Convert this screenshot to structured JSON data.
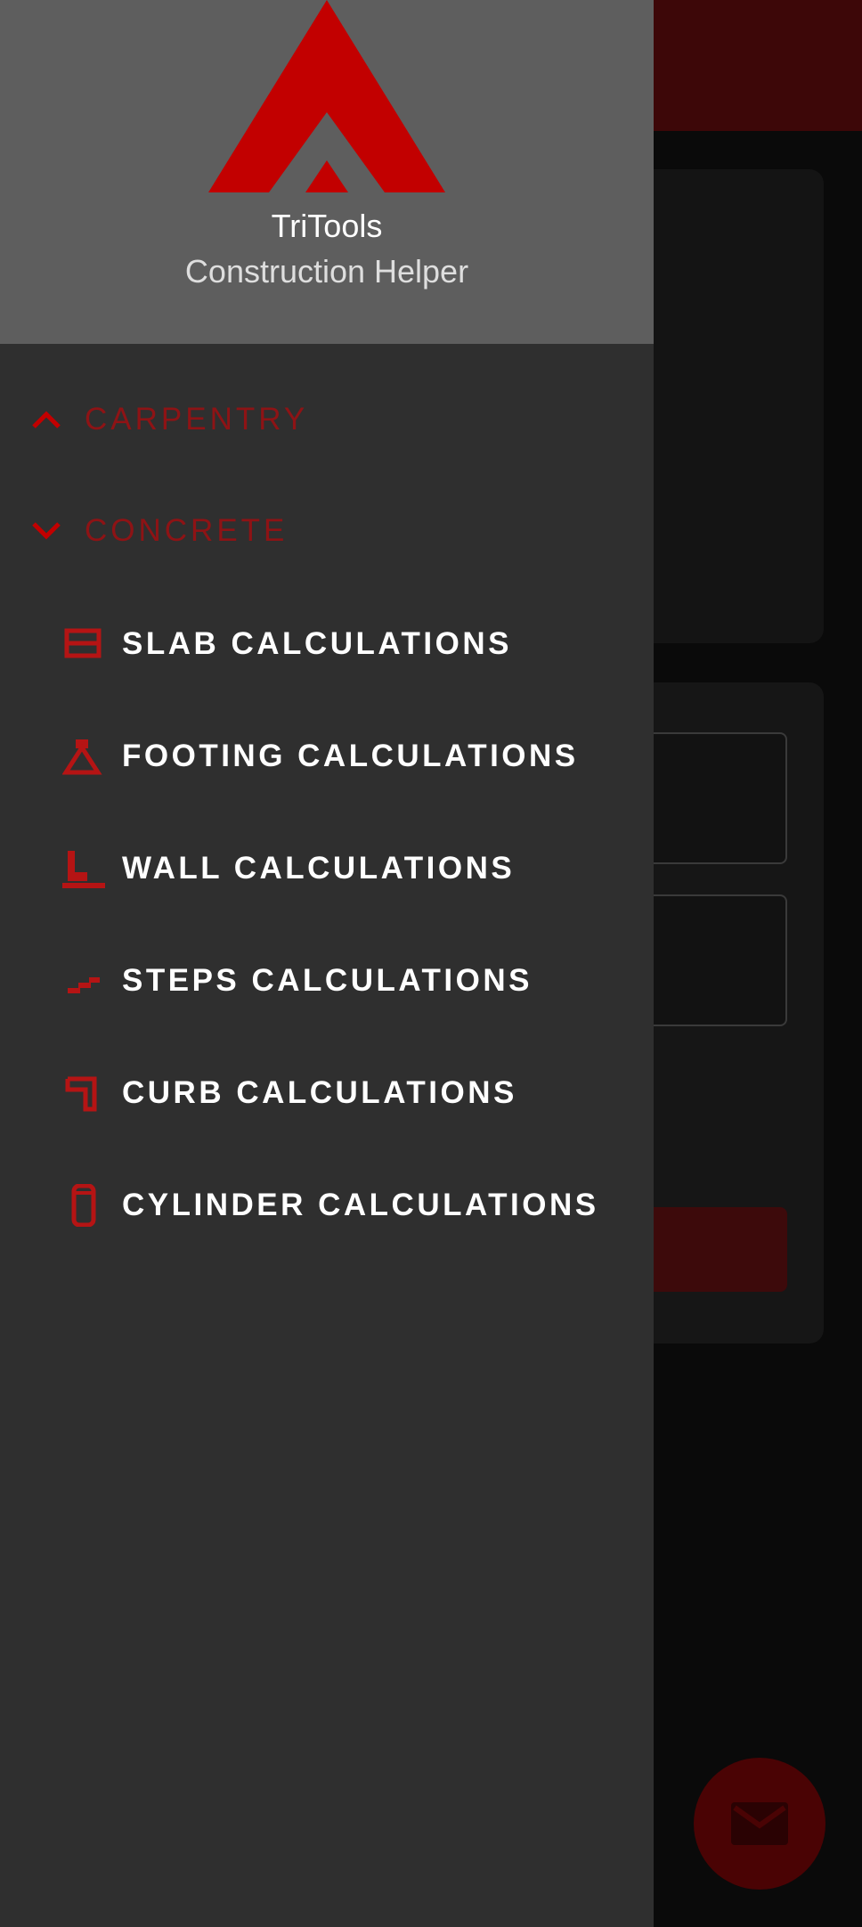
{
  "drawer": {
    "app_name": "TriTools",
    "app_subtitle": "Construction Helper",
    "groups": [
      {
        "label": "CARPENTRY",
        "icon": "chevron-up-icon",
        "expanded": false
      },
      {
        "label": "CONCRETE",
        "icon": "chevron-down-icon",
        "expanded": true
      }
    ],
    "items": [
      {
        "label": "SLAB CALCULATIONS",
        "icon": "slab-icon"
      },
      {
        "label": "FOOTING CALCULATIONS",
        "icon": "footing-icon"
      },
      {
        "label": "WALL CALCULATIONS",
        "icon": "wall-icon"
      },
      {
        "label": "STEPS CALCULATIONS",
        "icon": "steps-icon"
      },
      {
        "label": "CURB CALCULATIONS",
        "icon": "curb-icon"
      },
      {
        "label": "CYLINDER CALCULATIONS",
        "icon": "cylinder-icon"
      }
    ]
  },
  "background_app": {
    "fab_icon": "mail-icon"
  },
  "colors": {
    "accent": "#c20000",
    "group_label": "#8e1315",
    "drawer_bg": "#2f2f2f",
    "header_bg": "#5e5e5e"
  }
}
